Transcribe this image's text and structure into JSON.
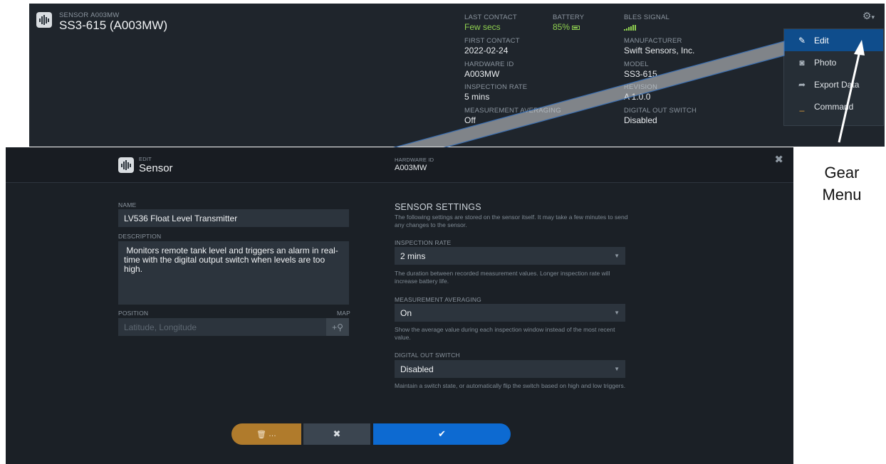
{
  "detail": {
    "subtitle_label": "SENSOR",
    "subtitle_id": "A003MW",
    "title": "SS3-615 (A003MW)",
    "last_contact": {
      "label": "LAST CONTACT",
      "value": "Few secs"
    },
    "battery": {
      "label": "BATTERY",
      "value": "85%"
    },
    "signal": {
      "label": "BLES SIGNAL"
    },
    "first_contact": {
      "label": "FIRST CONTACT",
      "value": "2022-02-24"
    },
    "manufacturer": {
      "label": "MANUFACTURER",
      "value": "Swift Sensors, Inc."
    },
    "hardware_id": {
      "label": "HARDWARE ID",
      "value": "A003MW"
    },
    "model": {
      "label": "MODEL",
      "value": "SS3-615"
    },
    "inspection_rate": {
      "label": "INSPECTION RATE",
      "value": "5 mins"
    },
    "revision": {
      "label": "REVISION",
      "value": "A 1.0.0"
    },
    "measurement_averaging": {
      "label": "MEASUREMENT AVERAGING",
      "value": "Off"
    },
    "digital_out_switch": {
      "label": "DIGITAL OUT SWITCH",
      "value": "Disabled"
    }
  },
  "gear_menu": {
    "items": [
      {
        "label": "Edit",
        "icon": "edit-icon"
      },
      {
        "label": "Photo",
        "icon": "camera-icon"
      },
      {
        "label": "Export Data",
        "icon": "share-icon"
      },
      {
        "label": "Command",
        "icon": "command-icon"
      }
    ]
  },
  "modal": {
    "edit_label": "EDIT",
    "title": "Sensor",
    "hardware_id_label": "HARDWARE ID",
    "hardware_id_value": "A003MW",
    "name_label": "NAME",
    "name_value": "LV536 Float Level Transmitter",
    "description_label": "DESCRIPTION",
    "description_value": " Monitors remote tank level and triggers an alarm in real-time with the digital output switch when levels are too high.",
    "position_label": "POSITION",
    "map_label": "MAP",
    "position_placeholder": "Latitude, Longitude",
    "settings_title": "SENSOR SETTINGS",
    "settings_help": "The following settings are stored on the sensor itself. It may take a few minutes to send any changes to the sensor.",
    "inspection_rate_label": "INSPECTION RATE",
    "inspection_rate_value": "2 mins",
    "inspection_rate_help": "The duration between recorded measurement values. Longer inspection rate will increase battery life.",
    "averaging_label": "MEASUREMENT AVERAGING",
    "averaging_value": "On",
    "averaging_help": "Show the average value during each inspection window instead of the most recent value.",
    "switch_label": "DIGITAL OUT SWITCH",
    "switch_value": "Disabled",
    "switch_help": "Maintain a switch state, or automatically flip the switch based on high and low triggers.",
    "delete_label": "…"
  },
  "annotation": {
    "line1": "Gear",
    "line2": "Menu"
  },
  "colors": {
    "accent": "#0d6ad1",
    "delete": "#b07b2c",
    "ok_green": "#8fd14f",
    "menu_active": "#0f4d8c"
  }
}
